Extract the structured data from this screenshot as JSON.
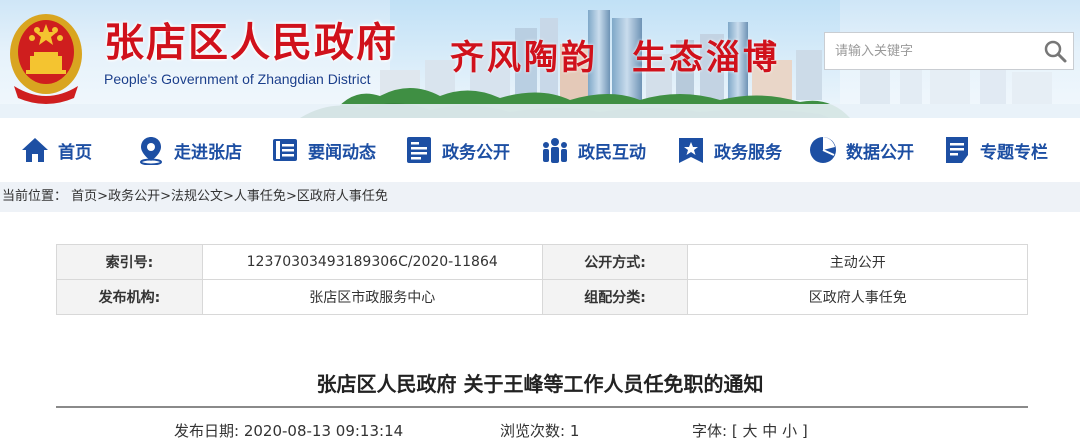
{
  "header": {
    "title": "张店区人民政府",
    "subtitle": "People's Government of Zhangdian District",
    "slogan_left": "齐风陶韵",
    "slogan_right": "生态淄博",
    "search": {
      "placeholder": "请输入关键字"
    }
  },
  "nav": {
    "items": [
      {
        "label": "首页",
        "icon": "home-icon"
      },
      {
        "label": "走进张店",
        "icon": "location-pin-icon"
      },
      {
        "label": "要闻动态",
        "icon": "news-list-icon"
      },
      {
        "label": "政务公开",
        "icon": "document-icon"
      },
      {
        "label": "政民互动",
        "icon": "people-icon"
      },
      {
        "label": "政务服务",
        "icon": "star-badge-icon"
      },
      {
        "label": "数据公开",
        "icon": "pie-chart-icon"
      },
      {
        "label": "专题专栏",
        "icon": "topic-icon"
      }
    ]
  },
  "breadcrumb": {
    "prefix": "当前位置：",
    "items": [
      "首页",
      "政务公开",
      "法规公文",
      "人事任免",
      "区政府人事任免"
    ]
  },
  "info": {
    "index_label": "索引号:",
    "index_value": "12370303493189306C/2020-11864",
    "mode_label": "公开方式:",
    "mode_value": "主动公开",
    "org_label": "发布机构:",
    "org_value": "张店区市政服务中心",
    "category_label": "组配分类:",
    "category_value": "区政府人事任免"
  },
  "article": {
    "title": "张店区人民政府 关于王峰等工作人员任免职的通知",
    "publish_label": "发布日期:",
    "publish_value": "2020-08-13 09:13:14",
    "views_label": "浏览次数:",
    "views_value": "1",
    "font_label": "字体:",
    "font_open": "[",
    "font_large": "大",
    "font_medium": "中",
    "font_small": "小",
    "font_close": "]"
  },
  "colors": {
    "brand_red": "#d0111b",
    "nav_blue": "#1d4fa3",
    "breadcrumb_bg": "#eef2f7"
  }
}
